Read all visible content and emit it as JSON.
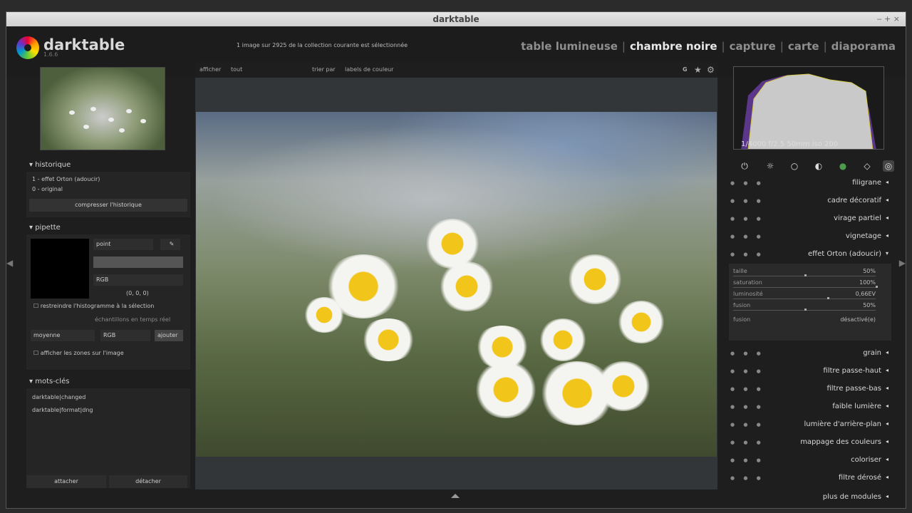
{
  "window": {
    "title": "darktable",
    "controls": "‒  +  ×"
  },
  "app": {
    "name": "darktable",
    "version": "1.6.6"
  },
  "status": "1 image sur 2925 de la collection courante est sélectionnée",
  "views": {
    "table": "table lumineuse",
    "darkroom": "chambre noire",
    "capture": "capture",
    "map": "carte",
    "slideshow": "diaporama"
  },
  "toolbar": {
    "show_label": "afficher",
    "show_value": "tout",
    "sort_label": "trier par",
    "sort_value": "labels de couleur",
    "star": "★",
    "gear": "⚙",
    "g": "G"
  },
  "history": {
    "title": "historique",
    "items": [
      "1 - effet Orton (adoucir)",
      "0 - original"
    ],
    "compress": "compresser l'historique"
  },
  "picker": {
    "title": "pipette",
    "mode": "point",
    "space": "RGB",
    "values": "(0, 0, 0)",
    "restrict": "restreindre l'histogramme à la sélection",
    "live": "échantillons en temps réel",
    "stat": "moyenne",
    "stat_space": "RGB",
    "add": "ajouter",
    "show_zones": "afficher les zones sur l'image"
  },
  "tags": {
    "title": "mots-clés",
    "items": [
      "darktable|changed",
      "darktable|format|dng"
    ],
    "attach": "attacher",
    "detach": "détacher"
  },
  "histogram": {
    "info": "1/4000 f/2.5 50mm iso 200"
  },
  "modules": [
    {
      "name": "filigrane"
    },
    {
      "name": "cadre décoratif"
    },
    {
      "name": "virage partiel"
    },
    {
      "name": "vignetage"
    },
    {
      "name": "effet Orton (adoucir)",
      "expanded": true
    },
    {
      "name": "grain"
    },
    {
      "name": "filtre passe-haut"
    },
    {
      "name": "filtre passe-bas"
    },
    {
      "name": "faible lumière"
    },
    {
      "name": "lumière d'arrière-plan"
    },
    {
      "name": "mappage des couleurs"
    },
    {
      "name": "coloriser"
    },
    {
      "name": "filtre dérosé"
    }
  ],
  "orton": {
    "sliders": [
      {
        "label": "taille",
        "value": "50%",
        "level": 0.5
      },
      {
        "label": "saturation",
        "value": "100%",
        "level": 1.0
      },
      {
        "label": "luminosité",
        "value": "0,66EV",
        "level": 0.66
      },
      {
        "label": "fusion",
        "value": "50%",
        "level": 0.5
      }
    ],
    "blend_label": "fusion",
    "blend_value": "désactivé(e)"
  },
  "more_modules": "plus de modules",
  "colors": {
    "bg": "#1e1e1e",
    "panel": "#252525",
    "accent": "#f2c51a"
  }
}
